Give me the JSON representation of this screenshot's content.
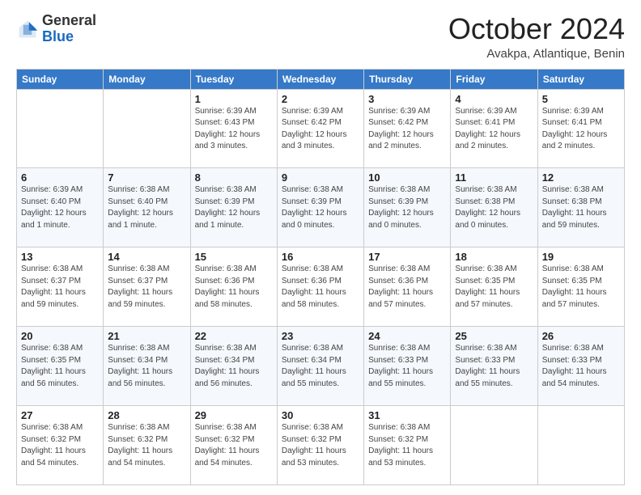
{
  "header": {
    "logo_general": "General",
    "logo_blue": "Blue",
    "month": "October 2024",
    "location": "Avakpa, Atlantique, Benin"
  },
  "weekdays": [
    "Sunday",
    "Monday",
    "Tuesday",
    "Wednesday",
    "Thursday",
    "Friday",
    "Saturday"
  ],
  "weeks": [
    [
      null,
      null,
      {
        "day": "1",
        "info": "Sunrise: 6:39 AM\nSunset: 6:43 PM\nDaylight: 12 hours\nand 3 minutes."
      },
      {
        "day": "2",
        "info": "Sunrise: 6:39 AM\nSunset: 6:42 PM\nDaylight: 12 hours\nand 3 minutes."
      },
      {
        "day": "3",
        "info": "Sunrise: 6:39 AM\nSunset: 6:42 PM\nDaylight: 12 hours\nand 2 minutes."
      },
      {
        "day": "4",
        "info": "Sunrise: 6:39 AM\nSunset: 6:41 PM\nDaylight: 12 hours\nand 2 minutes."
      },
      {
        "day": "5",
        "info": "Sunrise: 6:39 AM\nSunset: 6:41 PM\nDaylight: 12 hours\nand 2 minutes."
      }
    ],
    [
      {
        "day": "6",
        "info": "Sunrise: 6:39 AM\nSunset: 6:40 PM\nDaylight: 12 hours\nand 1 minute."
      },
      {
        "day": "7",
        "info": "Sunrise: 6:38 AM\nSunset: 6:40 PM\nDaylight: 12 hours\nand 1 minute."
      },
      {
        "day": "8",
        "info": "Sunrise: 6:38 AM\nSunset: 6:39 PM\nDaylight: 12 hours\nand 1 minute."
      },
      {
        "day": "9",
        "info": "Sunrise: 6:38 AM\nSunset: 6:39 PM\nDaylight: 12 hours\nand 0 minutes."
      },
      {
        "day": "10",
        "info": "Sunrise: 6:38 AM\nSunset: 6:39 PM\nDaylight: 12 hours\nand 0 minutes."
      },
      {
        "day": "11",
        "info": "Sunrise: 6:38 AM\nSunset: 6:38 PM\nDaylight: 12 hours\nand 0 minutes."
      },
      {
        "day": "12",
        "info": "Sunrise: 6:38 AM\nSunset: 6:38 PM\nDaylight: 11 hours\nand 59 minutes."
      }
    ],
    [
      {
        "day": "13",
        "info": "Sunrise: 6:38 AM\nSunset: 6:37 PM\nDaylight: 11 hours\nand 59 minutes."
      },
      {
        "day": "14",
        "info": "Sunrise: 6:38 AM\nSunset: 6:37 PM\nDaylight: 11 hours\nand 59 minutes."
      },
      {
        "day": "15",
        "info": "Sunrise: 6:38 AM\nSunset: 6:36 PM\nDaylight: 11 hours\nand 58 minutes."
      },
      {
        "day": "16",
        "info": "Sunrise: 6:38 AM\nSunset: 6:36 PM\nDaylight: 11 hours\nand 58 minutes."
      },
      {
        "day": "17",
        "info": "Sunrise: 6:38 AM\nSunset: 6:36 PM\nDaylight: 11 hours\nand 57 minutes."
      },
      {
        "day": "18",
        "info": "Sunrise: 6:38 AM\nSunset: 6:35 PM\nDaylight: 11 hours\nand 57 minutes."
      },
      {
        "day": "19",
        "info": "Sunrise: 6:38 AM\nSunset: 6:35 PM\nDaylight: 11 hours\nand 57 minutes."
      }
    ],
    [
      {
        "day": "20",
        "info": "Sunrise: 6:38 AM\nSunset: 6:35 PM\nDaylight: 11 hours\nand 56 minutes."
      },
      {
        "day": "21",
        "info": "Sunrise: 6:38 AM\nSunset: 6:34 PM\nDaylight: 11 hours\nand 56 minutes."
      },
      {
        "day": "22",
        "info": "Sunrise: 6:38 AM\nSunset: 6:34 PM\nDaylight: 11 hours\nand 56 minutes."
      },
      {
        "day": "23",
        "info": "Sunrise: 6:38 AM\nSunset: 6:34 PM\nDaylight: 11 hours\nand 55 minutes."
      },
      {
        "day": "24",
        "info": "Sunrise: 6:38 AM\nSunset: 6:33 PM\nDaylight: 11 hours\nand 55 minutes."
      },
      {
        "day": "25",
        "info": "Sunrise: 6:38 AM\nSunset: 6:33 PM\nDaylight: 11 hours\nand 55 minutes."
      },
      {
        "day": "26",
        "info": "Sunrise: 6:38 AM\nSunset: 6:33 PM\nDaylight: 11 hours\nand 54 minutes."
      }
    ],
    [
      {
        "day": "27",
        "info": "Sunrise: 6:38 AM\nSunset: 6:32 PM\nDaylight: 11 hours\nand 54 minutes."
      },
      {
        "day": "28",
        "info": "Sunrise: 6:38 AM\nSunset: 6:32 PM\nDaylight: 11 hours\nand 54 minutes."
      },
      {
        "day": "29",
        "info": "Sunrise: 6:38 AM\nSunset: 6:32 PM\nDaylight: 11 hours\nand 54 minutes."
      },
      {
        "day": "30",
        "info": "Sunrise: 6:38 AM\nSunset: 6:32 PM\nDaylight: 11 hours\nand 53 minutes."
      },
      {
        "day": "31",
        "info": "Sunrise: 6:38 AM\nSunset: 6:32 PM\nDaylight: 11 hours\nand 53 minutes."
      },
      null,
      null
    ]
  ]
}
